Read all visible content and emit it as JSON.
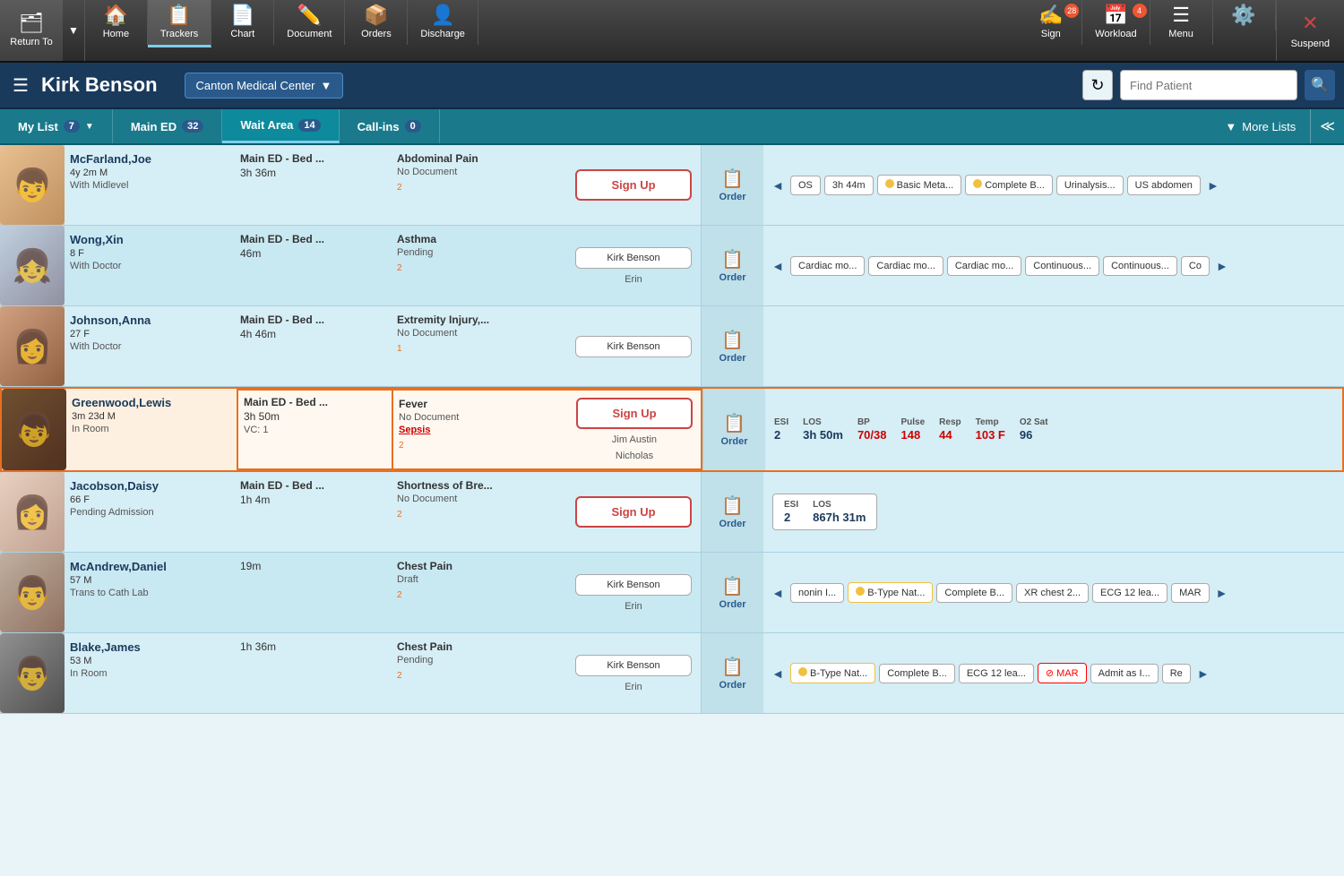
{
  "toolbar": {
    "buttons": [
      {
        "id": "return-to",
        "label": "Return To",
        "icon": "🗂",
        "active": false
      },
      {
        "id": "home",
        "label": "Home",
        "icon": "🏠",
        "active": false
      },
      {
        "id": "trackers",
        "label": "Trackers",
        "icon": "📋",
        "active": true
      },
      {
        "id": "chart",
        "label": "Chart",
        "icon": "📄",
        "active": false
      },
      {
        "id": "document",
        "label": "Document",
        "icon": "✏️",
        "active": false
      },
      {
        "id": "orders",
        "label": "Orders",
        "icon": "📦",
        "active": false
      },
      {
        "id": "discharge",
        "label": "Discharge",
        "icon": "👤",
        "active": false
      },
      {
        "id": "sign",
        "label": "Sign",
        "icon": "✍️",
        "active": false,
        "badge": "28"
      },
      {
        "id": "workload",
        "label": "Workload",
        "icon": "📅",
        "active": false,
        "badge": "4"
      },
      {
        "id": "menu",
        "label": "Menu",
        "icon": "☰",
        "active": false
      },
      {
        "id": "settings",
        "label": "",
        "icon": "⚙️",
        "active": false
      },
      {
        "id": "suspend",
        "label": "Suspend",
        "icon": "✕",
        "active": false
      }
    ]
  },
  "header": {
    "menu_icon": "☰",
    "patient_name": "Kirk Benson",
    "facility": "Canton Medical Center",
    "refresh_icon": "↻",
    "find_patient_placeholder": "Find Patient",
    "search_icon": "🔍"
  },
  "tabs": [
    {
      "id": "my-list",
      "label": "My List",
      "count": "7",
      "active": false,
      "has_dropdown": true
    },
    {
      "id": "main-ed",
      "label": "Main ED",
      "count": "32",
      "active": false
    },
    {
      "id": "wait-area",
      "label": "Wait Area",
      "count": "14",
      "active": true
    },
    {
      "id": "call-ins",
      "label": "Call-ins",
      "count": "0",
      "active": false
    },
    {
      "id": "more-lists",
      "label": "▼ More Lists",
      "active": false
    }
  ],
  "patients": [
    {
      "id": "mcfarland",
      "name": "McFarland,Joe",
      "age": "4y 2m M",
      "status": "With Midlevel",
      "location": "Main ED - Bed ...",
      "time": "3h 36m",
      "extra": "",
      "complaint": "Abdominal Pain",
      "doc_status": "No Document",
      "alert": "",
      "row_num": "2",
      "sign_btn": "Sign Up",
      "sign_type": "signup",
      "provider": "",
      "highlighted": false,
      "orders": [
        "OS",
        "3h 44m",
        "Basic Meta...",
        "Complete B...",
        "Urinalysis...",
        "US abdomen"
      ],
      "orders_type": "mixed",
      "vitals": null,
      "esi_los": null
    },
    {
      "id": "wong",
      "name": "Wong,Xin",
      "age": "8 F",
      "status": "With Doctor",
      "location": "Main ED - Bed ...",
      "time": "46m",
      "extra": "",
      "complaint": "Asthma",
      "doc_status": "Pending",
      "alert": "",
      "row_num": "2",
      "sign_btn": "Kirk Benson",
      "sign_type": "provider",
      "provider": "Erin",
      "highlighted": false,
      "orders": [
        "Cardiac mo...",
        "Cardiac mo...",
        "Cardiac mo...",
        "Continuous...",
        "Continuous...",
        "Co"
      ],
      "orders_type": "plain",
      "vitals": null,
      "esi_los": null
    },
    {
      "id": "johnson",
      "name": "Johnson,Anna",
      "age": "27 F",
      "status": "With Doctor",
      "location": "Main ED - Bed ...",
      "time": "4h 46m",
      "extra": "",
      "complaint": "Extremity Injury,...",
      "doc_status": "No Document",
      "alert": "",
      "row_num": "1",
      "sign_btn": "Kirk Benson",
      "sign_type": "provider",
      "provider": "",
      "highlighted": false,
      "orders": [],
      "orders_type": "empty",
      "vitals": null,
      "esi_los": null
    },
    {
      "id": "greenwood",
      "name": "Greenwood,Lewis",
      "age": "3m 23d M",
      "status": "In Room",
      "location": "Main ED - Bed ...",
      "time": "3h 50m",
      "extra": "VC: 1",
      "complaint": "Fever",
      "doc_status": "No Document",
      "alert": "Sepsis",
      "row_num": "2",
      "sign_btn": "Sign Up",
      "sign_type": "signup",
      "provider2": "Jim Austin",
      "provider": "Nicholas",
      "highlighted": true,
      "orders": [],
      "orders_type": "vitals",
      "vitals": {
        "esi": "2",
        "los": "3h 50m",
        "bp": "70/38",
        "pulse": "148",
        "resp": "44",
        "temp": "103 F",
        "o2sat": "96"
      },
      "esi_los": null
    },
    {
      "id": "jacobson",
      "name": "Jacobson,Daisy",
      "age": "66 F",
      "status": "Pending Admission",
      "location": "Main ED - Bed ...",
      "time": "1h 4m",
      "extra": "",
      "complaint": "Shortness of Bre...",
      "doc_status": "No Document",
      "alert": "",
      "row_num": "2",
      "sign_btn": "Sign Up",
      "sign_type": "signup",
      "provider": "",
      "highlighted": false,
      "orders": [],
      "orders_type": "esi",
      "vitals": null,
      "esi_los": {
        "esi": "2",
        "los": "867h 31m"
      }
    },
    {
      "id": "mcandrew",
      "name": "McAndrew,Daniel",
      "age": "57 M",
      "status": "Trans to Cath Lab",
      "location": "",
      "time": "19m",
      "extra": "",
      "complaint": "Chest Pain",
      "doc_status": "Draft",
      "alert": "",
      "row_num": "2",
      "sign_btn": "Kirk Benson",
      "sign_type": "provider",
      "provider": "Erin",
      "highlighted": false,
      "orders": [
        "◄",
        "nonin I...",
        "B-Type Nat...",
        "Complete B...",
        "XR chest 2...",
        "ECG 12 lea...",
        "MAR",
        "►"
      ],
      "orders_type": "complex",
      "vitals": null,
      "esi_los": null
    },
    {
      "id": "blake",
      "name": "Blake,James",
      "age": "53 M",
      "status": "In Room",
      "location": "",
      "time": "1h 36m",
      "extra": "",
      "complaint": "Chest Pain",
      "doc_status": "Pending",
      "alert": "",
      "row_num": "2",
      "sign_btn": "Kirk Benson",
      "sign_type": "provider",
      "provider": "Erin",
      "highlighted": false,
      "orders": [
        "◄",
        "B-Type Nat...",
        "Complete B...",
        "ECG 12 lea...",
        "MAR",
        "Admit as I...",
        "Re",
        "►"
      ],
      "orders_type": "complex2",
      "vitals": null,
      "esi_los": null
    }
  ]
}
